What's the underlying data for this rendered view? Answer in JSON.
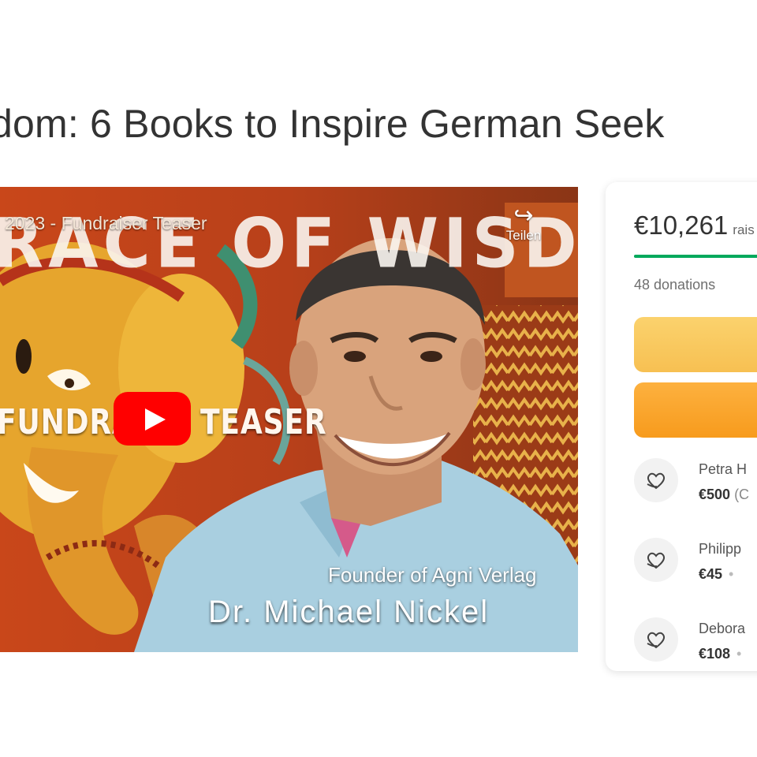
{
  "page": {
    "title": "dom: 6 Books to Inspire German Seek"
  },
  "video": {
    "title": "2023 - Fundraiser Teaser",
    "banner_text": "RACE OF WISDOM",
    "share_label": "Teilen",
    "overlay_left": "FUNDRA",
    "overlay_right": "TEASER",
    "caption_small": "Founder of Agni Verlag",
    "caption_big": "Dr. Michael Nickel"
  },
  "donation_card": {
    "amount_raised": "€10,261",
    "raised_suffix": "rais",
    "progress_fraction": 1.0,
    "donations_count": "48 donations",
    "colors": {
      "progress": "#02a95c",
      "share_button": "#f7c052",
      "donate_button": "#f79b1d"
    },
    "donors": [
      {
        "name": "Petra H",
        "amount": "€500",
        "extra": "(C"
      },
      {
        "name": "Philipp",
        "amount": "€45",
        "extra": "•"
      },
      {
        "name": "Debora",
        "amount": "€108",
        "extra": "•"
      }
    ]
  }
}
